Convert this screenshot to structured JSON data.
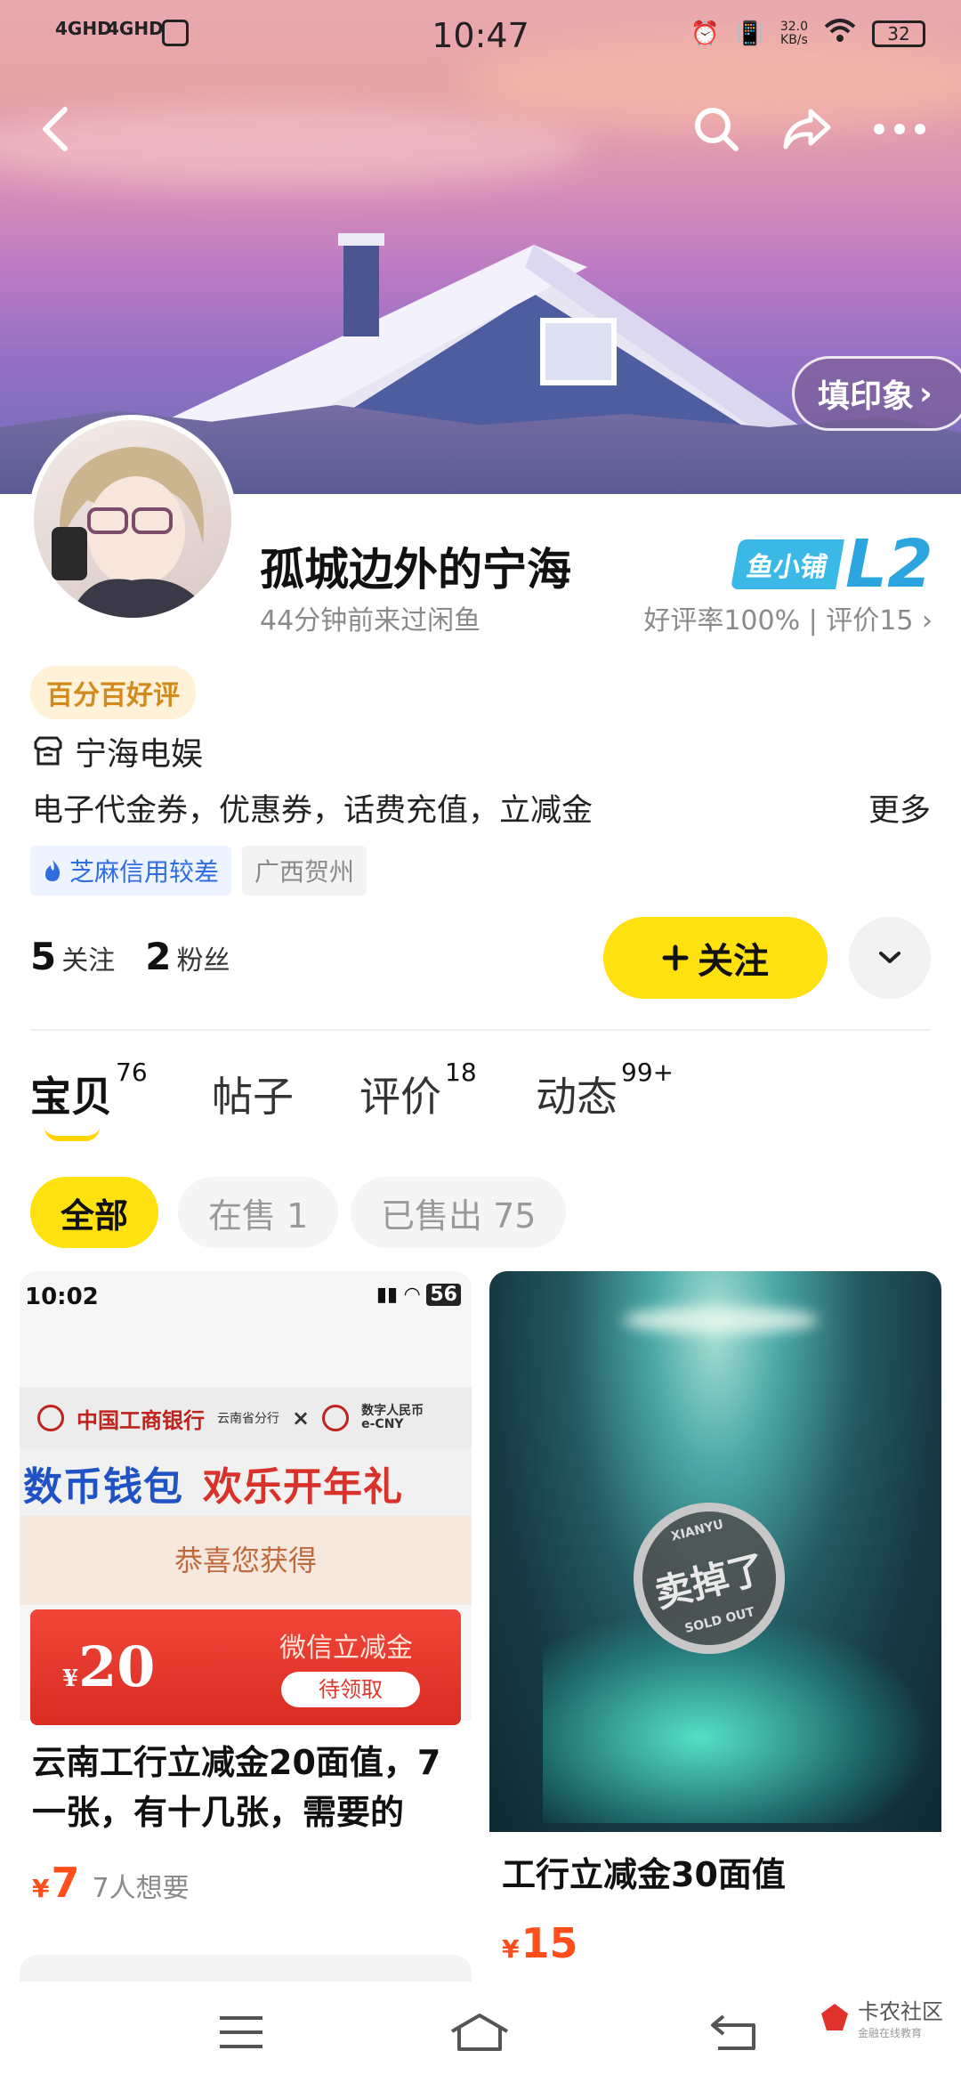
{
  "status_bar": {
    "time": "10:47",
    "net1": "4GHD",
    "net2": "4GHD",
    "speed_value": "32.0",
    "speed_unit": "KB/s",
    "battery": "32"
  },
  "header": {
    "imprint_label": "填印象"
  },
  "profile": {
    "nickname": "孤城边外的宁海",
    "last_seen": "44分钟前来过闲鱼",
    "shop_badge_label": "鱼小铺",
    "shop_level": "L2",
    "rating_text": "好评率100% | 评价15",
    "tag": "百分百好评",
    "shop_name": "宁海电娱",
    "description": "电子代金券，优惠券，话费充值，立减金",
    "more_label": "更多",
    "credit_chip": "芝麻信用较差",
    "location_chip": "广西贺州",
    "following_count": "5",
    "following_label": "关注",
    "fans_count": "2",
    "fans_label": "粉丝",
    "follow_button": "关注",
    "accent_color": "#ffe10f"
  },
  "tabs": [
    {
      "label": "宝贝",
      "count": "76",
      "active": true
    },
    {
      "label": "帖子",
      "count": ""
    },
    {
      "label": "评价",
      "count": "18"
    },
    {
      "label": "动态",
      "count": "99+"
    }
  ],
  "filters": [
    {
      "label": "全部",
      "active": true
    },
    {
      "label": "在售 1"
    },
    {
      "label": "已售出 75"
    }
  ],
  "products": [
    {
      "title": "云南工行立减金20面值，7一张，有十几张，需要的",
      "currency": "¥",
      "price": "7",
      "wants": "7人想要",
      "thumb": {
        "phone_time": "10:02",
        "phone_battery": "56",
        "bank_name": "中国工商银行",
        "bank_branch": "云南省分行",
        "ecny_label": "数字人民币",
        "ecny_sub": "e-CNY",
        "slogan_blue": "数币钱包",
        "slogan_red": "欢乐开年礼",
        "congrats": "恭喜您获得",
        "coupon_currency": "¥",
        "coupon_amount": "20",
        "coupon_title": "微信立减金",
        "coupon_button": "待领取"
      }
    },
    {
      "title": "工行立减金30面值",
      "currency": "¥",
      "price": "15",
      "sold_stamp": "卖掉了",
      "stamp_top": "XIANYU",
      "stamp_bottom": "SOLD OUT"
    }
  ],
  "watermark": {
    "name": "卡农社区",
    "sub": "金融在线教育"
  }
}
